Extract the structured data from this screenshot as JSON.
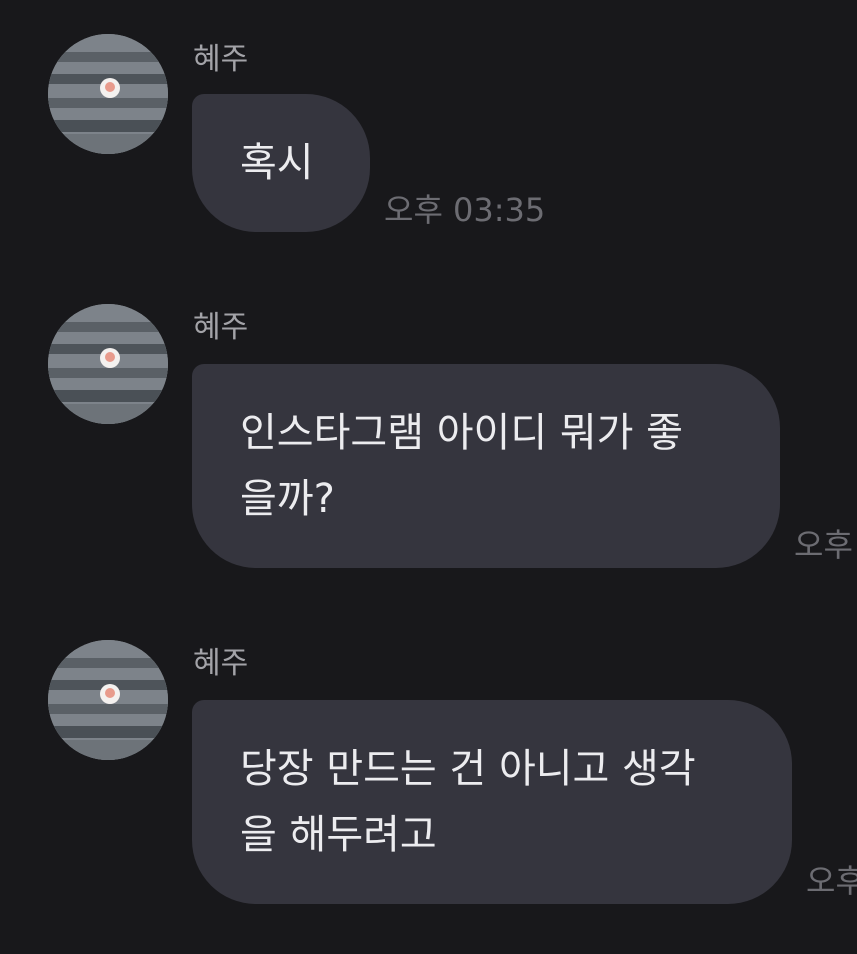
{
  "messages": [
    {
      "sender": "혜주",
      "avatar": "profile-photo",
      "text": "혹시",
      "time": "오후 03:35"
    },
    {
      "sender": "혜주",
      "avatar": "profile-photo",
      "text": "인스타그램 아이디 뭐가 좋\n을까?",
      "time": "오후"
    },
    {
      "sender": "혜주",
      "avatar": "profile-photo",
      "text": "당장 만드는 건 아니고 생각\n을 해두려고",
      "time": "오후"
    }
  ],
  "colors": {
    "background": "#18181b",
    "bubble": "#35353e",
    "bubble_text": "#ececef",
    "sender_text": "#a3a3a8",
    "time_text": "#6c6c72"
  }
}
